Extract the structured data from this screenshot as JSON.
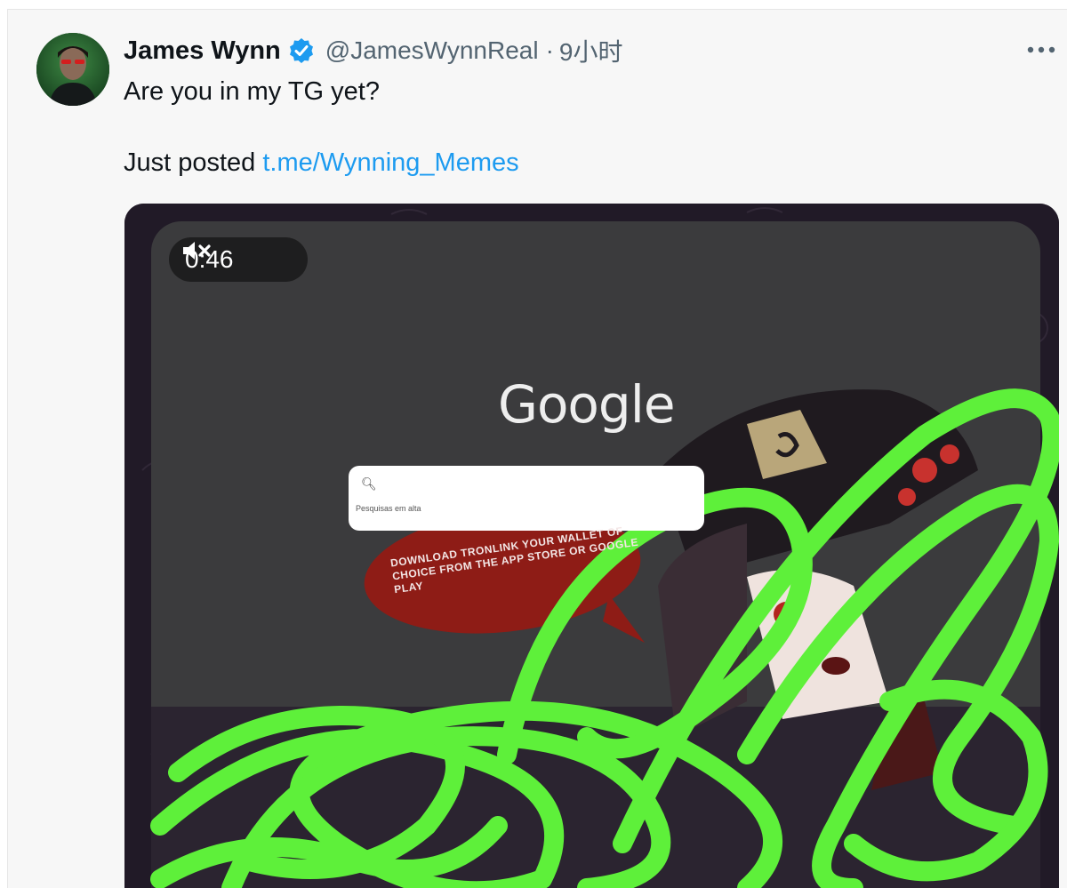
{
  "tweet": {
    "author_name": "James Wynn",
    "handle": "@JamesWynnReal",
    "separator": "·",
    "time": "9小时",
    "line1": "Are you in my TG yet?",
    "line2_prefix": "Just posted ",
    "link": "t.me/Wynning_Memes",
    "more_icon": "more-horizontal-icon",
    "verified_icon": "verified-badge-icon",
    "verified_color": "#1d9bf0"
  },
  "media": {
    "video_time": "0:46",
    "mute_icon": "muted-speaker-icon",
    "google_text": "Google",
    "search_trending": "Pesquisas em alta",
    "bubble_text": "DOWNLOAD TRONLINK YOUR WALLET OF CHOICE FROM THE APP STORE OR GOOGLE PLAY",
    "scribble_color": "#5ef03a"
  }
}
